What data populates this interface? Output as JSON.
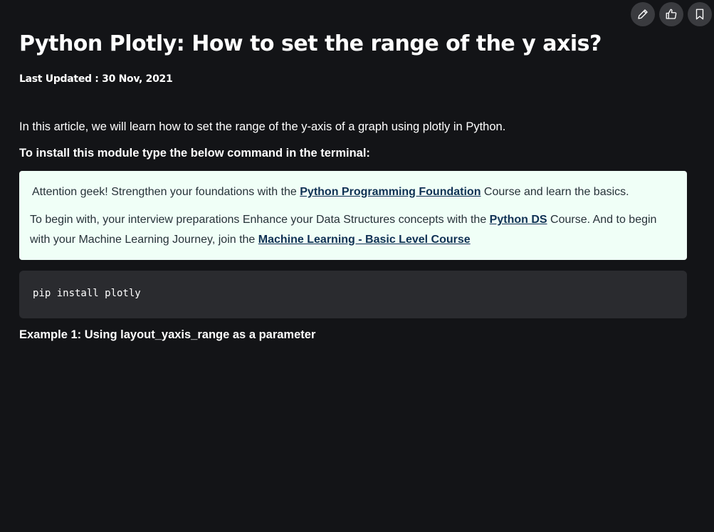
{
  "toolbar": {
    "edit_icon": "pencil-icon",
    "like_icon": "thumbs-up-icon",
    "bookmark_icon": "bookmark-icon"
  },
  "article": {
    "title": "Python Plotly: How to set the range of the y axis?",
    "last_updated": "Last Updated : 30 Nov, 2021",
    "intro": "In this article, we will learn how to set the range of the y-axis of a graph using plotly in Python.",
    "install_heading": "To install this module type the below command in the terminal:",
    "notice": {
      "line1_prefix": "Attention geek! Strengthen your foundations with the ",
      "line1_link": "Python Programming Foundation",
      "line1_suffix": " Course and learn the basics.",
      "para2_prefix": "To begin with, your interview preparations Enhance your Data Structures concepts with the ",
      "para2_link1": "Python DS",
      "para2_middle": " Course. And to begin with your Machine Learning Journey, join the ",
      "para2_link2": "Machine Learning - Basic Level Course"
    },
    "code": "pip install plotly",
    "example_heading": "Example 1: Using layout_yaxis_range as a parameter"
  },
  "colors": {
    "background": "#131417",
    "notice_bg": "#f0fff7",
    "notice_link": "#0f3154",
    "code_bg": "#2a2b2f",
    "toolbar_btn": "#3a3b3f"
  }
}
